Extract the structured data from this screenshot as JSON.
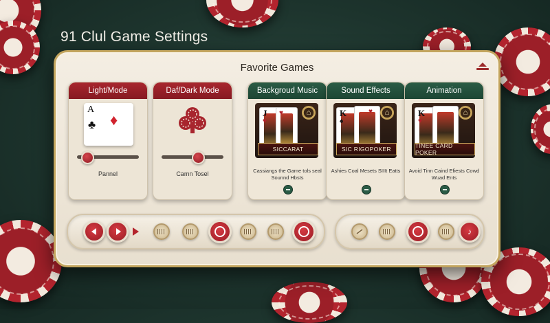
{
  "app_title": "91 Clul Game Settings",
  "panel": {
    "title": "Favorite Games"
  },
  "mode_cards": [
    {
      "header": "Light/Mode",
      "card_rank": "A",
      "caption": "Pannel",
      "slider_value": 0.12
    },
    {
      "header": "Daf/Dark Mode",
      "caption": "Camn Tosel",
      "slider_value": 0.55
    }
  ],
  "game_cards": [
    {
      "header": "Backgroud Music",
      "card_rank": "J",
      "game_name": "SICCARAT",
      "description": "Cassiangs the Game tols seal Sounnd Hbsts"
    },
    {
      "header": "Sound Effects",
      "card_rank": "K",
      "game_name": "SIC RIGOPOKER",
      "description": "Ashies Coal Mesets SIIIt Eatts"
    },
    {
      "header": "Animation",
      "card_rank": "K",
      "game_name": "TINEE CARD POKER",
      "description": "Avoid Tinn Caind Efiests Cowd Wuad Ents"
    }
  ],
  "colors": {
    "accent_red": "#a8262e",
    "accent_green": "#2a5b45",
    "felt": "#1d342d",
    "gold": "#c3a55e"
  }
}
